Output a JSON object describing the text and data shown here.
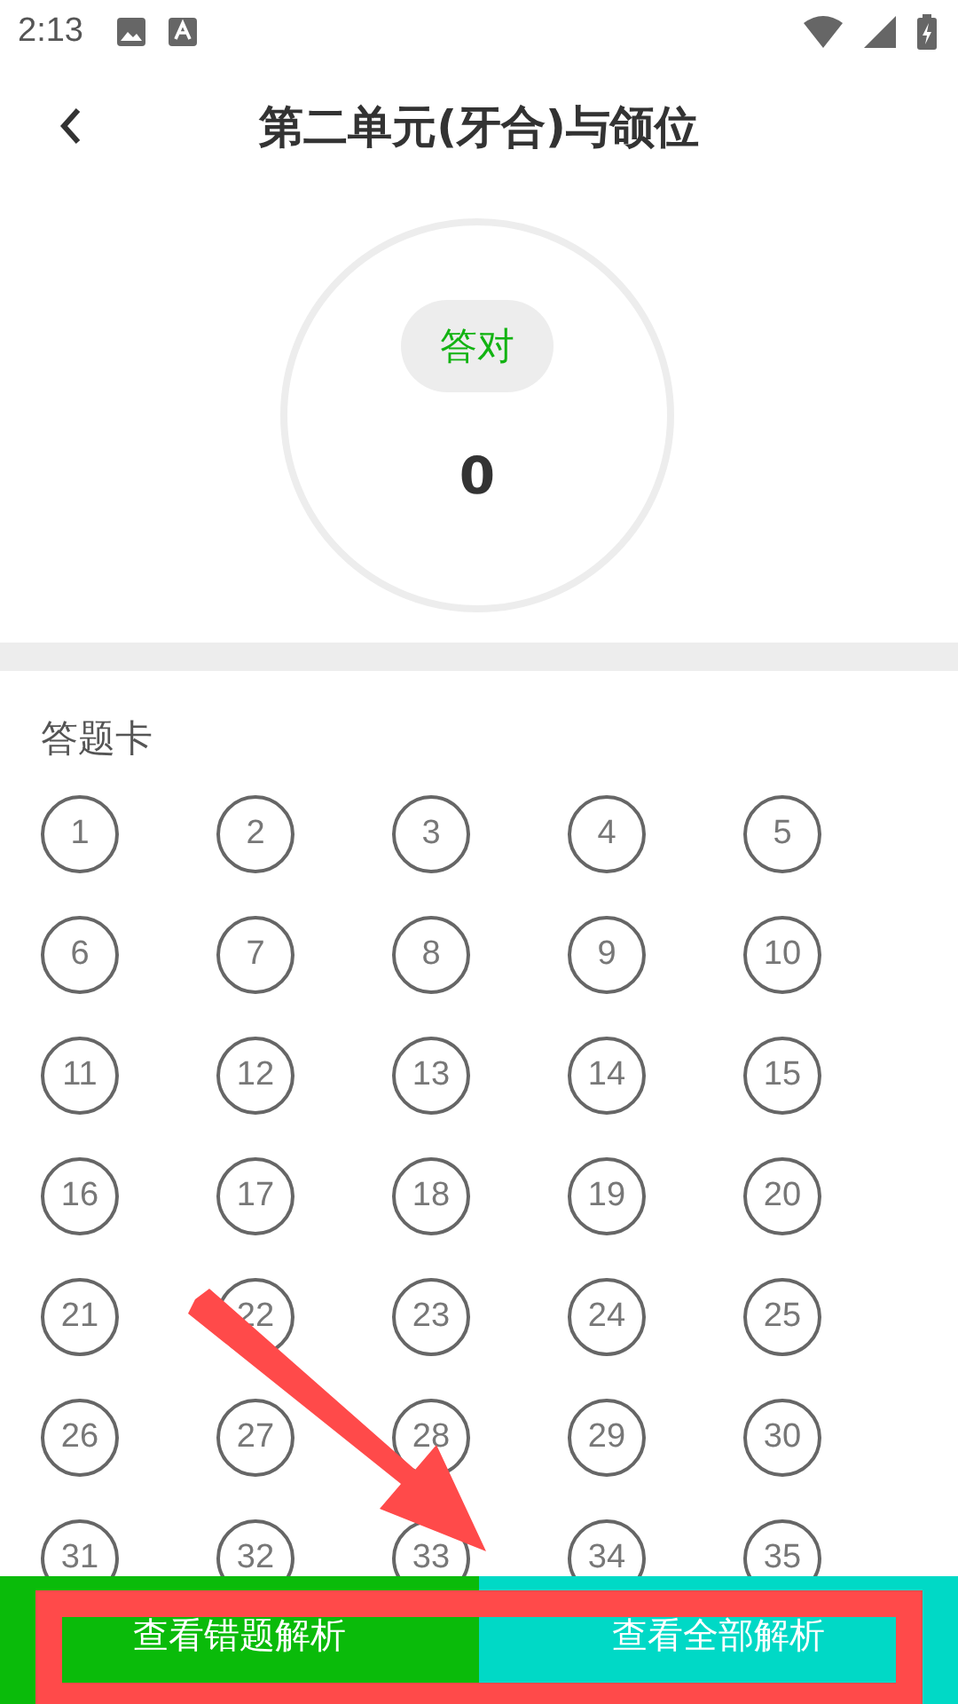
{
  "status_bar": {
    "time": "2:13"
  },
  "header": {
    "title": "第二单元(牙合)与颌位"
  },
  "score": {
    "label": "答对",
    "value": "0"
  },
  "answer_card": {
    "title": "答题卡",
    "questions": [
      "1",
      "2",
      "3",
      "4",
      "5",
      "6",
      "7",
      "8",
      "9",
      "10",
      "11",
      "12",
      "13",
      "14",
      "15",
      "16",
      "17",
      "18",
      "19",
      "20",
      "21",
      "22",
      "23",
      "24",
      "25",
      "26",
      "27",
      "28",
      "29",
      "30",
      "31",
      "32",
      "33",
      "34",
      "35"
    ]
  },
  "buttons": [
    {
      "label": "查看错题解析",
      "color": "#0abb0a"
    },
    {
      "label": "查看全部解析",
      "color": "#00d9c6"
    }
  ]
}
